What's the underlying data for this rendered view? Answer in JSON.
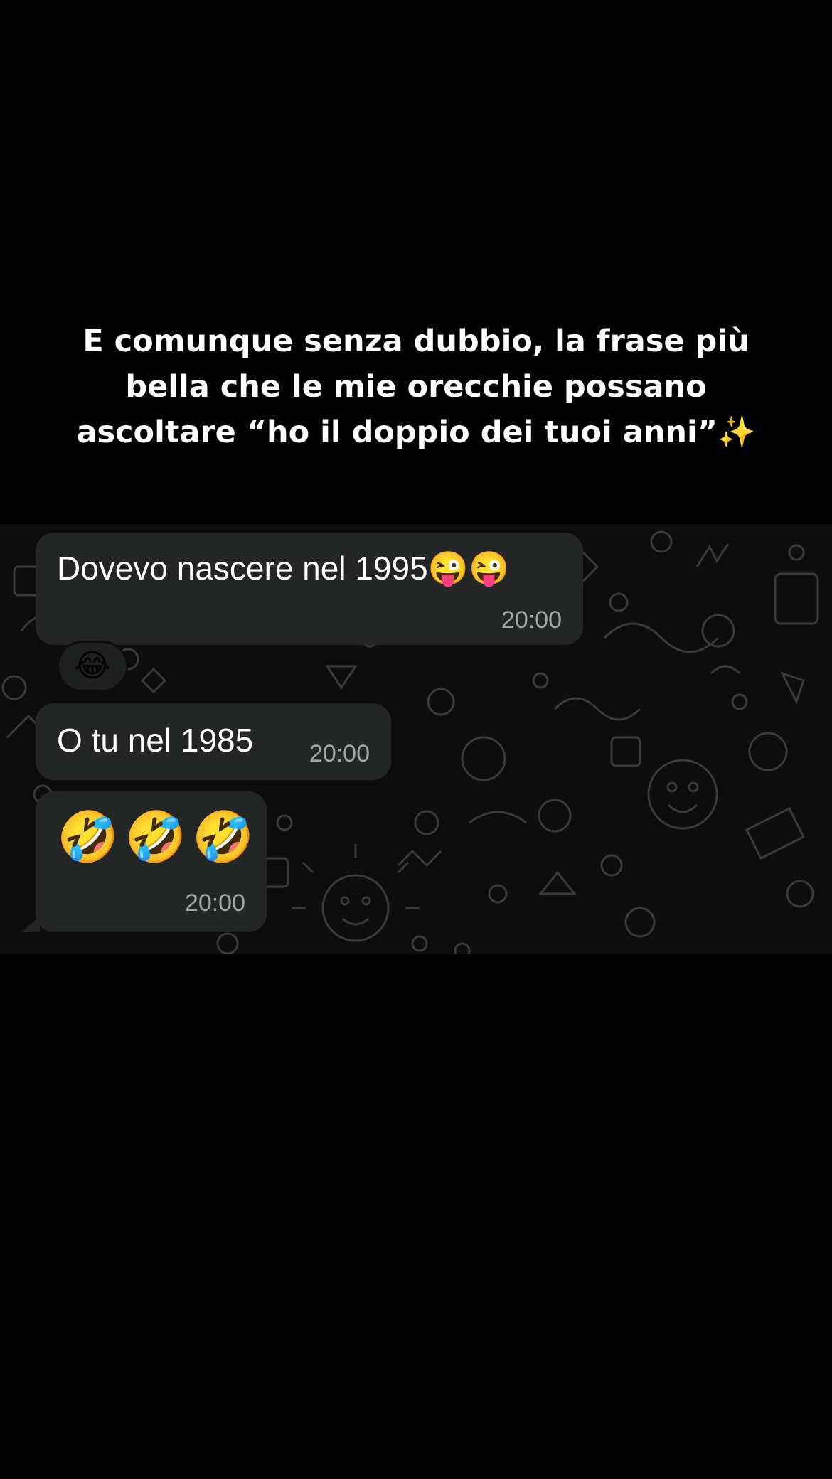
{
  "caption": {
    "text": "E comunque senza dubbio, la frase più\nbella che le mie orecchie possano\nascoltare “ho il doppio dei tuoi anni”✨"
  },
  "chat": {
    "messages": [
      {
        "text": "Dovevo nascere nel 1995😜😜",
        "time": "20:00",
        "reaction": "😂"
      },
      {
        "text": "O tu nel 1985",
        "time": "20:00"
      },
      {
        "text": "🤣🤣🤣",
        "time": "20:00"
      }
    ]
  },
  "colors": {
    "page_background": "#000000",
    "chat_background": "#0d0d0d",
    "bubble": "#242626",
    "timestamp": "#a3a6a8",
    "text": "#ffffff"
  }
}
